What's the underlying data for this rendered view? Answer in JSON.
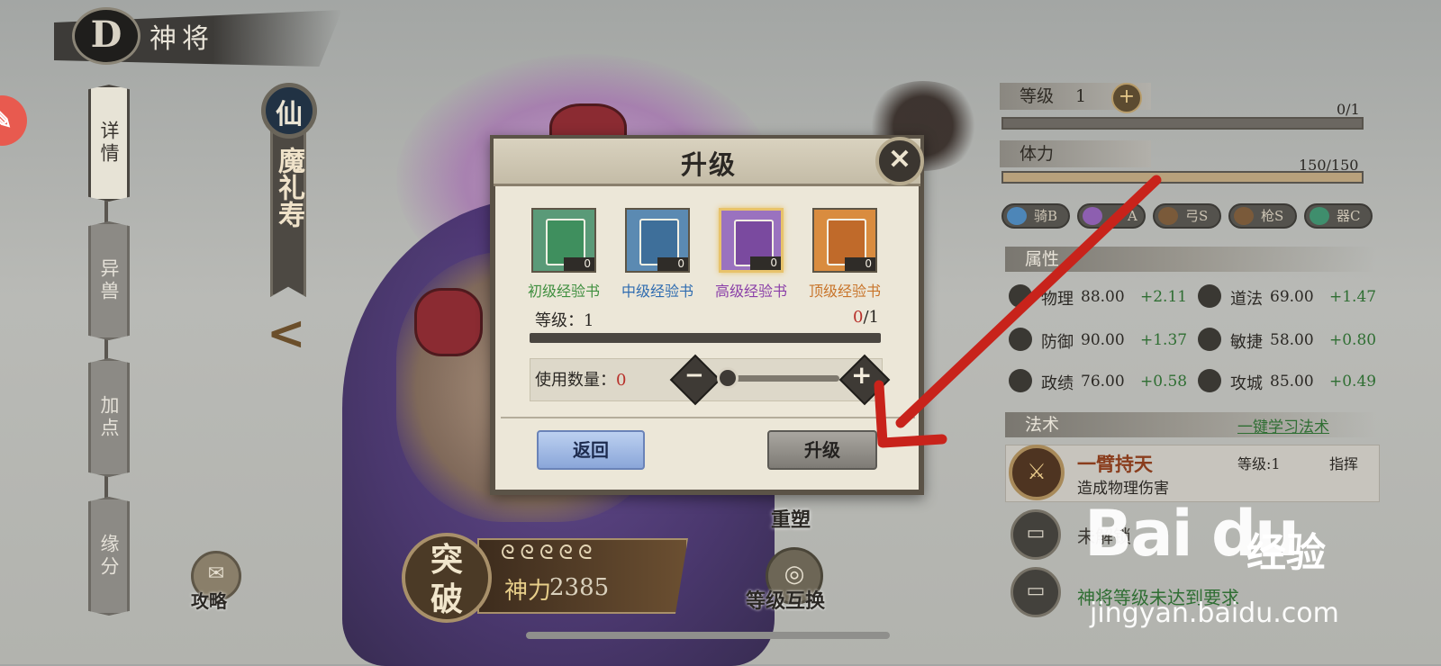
{
  "topbar": {
    "title": "神将",
    "logo_glyph": "D"
  },
  "left_tabs": [
    {
      "label": "详情",
      "active": true
    },
    {
      "label": "异兽",
      "active": false
    },
    {
      "label": "加点",
      "active": false
    },
    {
      "label": "缘分",
      "active": false
    }
  ],
  "hero": {
    "faction_badge": "仙",
    "name": "魔礼寿",
    "prev_arrow": "<"
  },
  "bottom_left": {
    "guide_label": "攻略",
    "breakthrough": "突破",
    "spiral_glyphs": "ᘓᘓᘓᘓᘓ",
    "power_label": "神力",
    "power_value": "2385",
    "reshape_label": "重塑",
    "swap_label": "等级互换"
  },
  "right_panel": {
    "level_label": "等级",
    "level_value": "1",
    "plus_glyph": "+",
    "exp_text": "0/1",
    "stamina_label": "体力",
    "stamina_text": "150/150",
    "stamina_fraction": 1.0,
    "tags": [
      {
        "label": "骑B",
        "color": "#4d86b8"
      },
      {
        "label": "A",
        "color": "#8d5fb0"
      },
      {
        "label": "弓S",
        "color": "#7a5a3a"
      },
      {
        "label": "枪S",
        "color": "#7a5a3a"
      },
      {
        "label": "器C",
        "color": "#3f8e6d"
      }
    ],
    "attr_header": "属性",
    "attrs": [
      {
        "name": "物理",
        "value": "88.00",
        "bonus": "+2.11"
      },
      {
        "name": "道法",
        "value": "69.00",
        "bonus": "+1.47"
      },
      {
        "name": "防御",
        "value": "90.00",
        "bonus": "+1.37"
      },
      {
        "name": "敏捷",
        "value": "58.00",
        "bonus": "+0.80"
      },
      {
        "name": "政绩",
        "value": "76.00",
        "bonus": "+0.58"
      },
      {
        "name": "攻城",
        "value": "85.00",
        "bonus": "+0.49"
      }
    ],
    "skill_header": "法术",
    "one_key_learn": "一键学习法术",
    "skill": {
      "name": "一臂持天",
      "desc": "造成物理伤害",
      "level": "等级:1",
      "type": "指挥"
    },
    "locked_1": "未解锁",
    "locked_2": "神将等级未达到要求"
  },
  "dialog": {
    "title": "升级",
    "close_glyph": "✕",
    "books": [
      {
        "name": "初级经验书",
        "count": "0",
        "color": "#3f8f5e",
        "bg": "#5a9a78",
        "name_color": "#3f8f3f",
        "selected": false
      },
      {
        "name": "中级经验书",
        "count": "0",
        "color": "#3e6f9a",
        "bg": "#5b8ab2",
        "name_color": "#2f6cb0",
        "selected": false
      },
      {
        "name": "高级经验书",
        "count": "0",
        "color": "#7a4a9f",
        "bg": "#9a72bf",
        "name_color": "#8a3fa8",
        "selected": true
      },
      {
        "name": "顶级经验书",
        "count": "0",
        "color": "#c06a2a",
        "bg": "#d98c3f",
        "name_color": "#c8742a",
        "selected": false
      }
    ],
    "level_label": "等级：1",
    "level_current": "0",
    "level_max": "/1",
    "use_label": "使用数量：",
    "use_count": "0",
    "minus_glyph": "−",
    "plus_glyph": "+",
    "back_label": "返回",
    "upgrade_label": "升级"
  },
  "watermark": {
    "logo": "Bai du",
    "cn": "经验",
    "url": "jingyan.baidu.com"
  },
  "colors": {
    "arrow": "#c8231b",
    "accent_green": "#2f6e33",
    "accent_red": "#b8312b"
  }
}
